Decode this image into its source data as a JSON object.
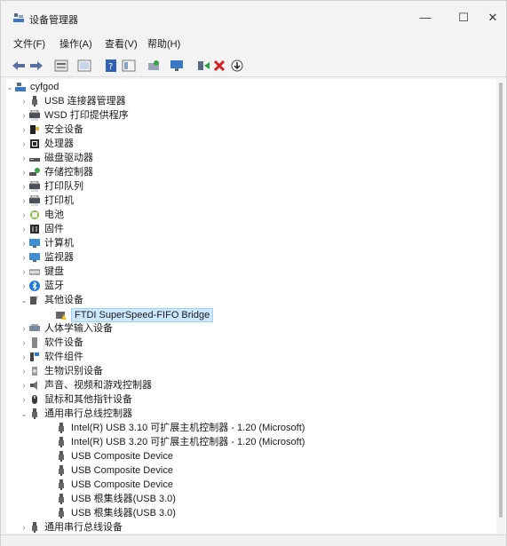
{
  "window": {
    "title": "设备管理器",
    "minimize": "—",
    "maximize": "☐",
    "close": "✕"
  },
  "menu": [
    "文件(F)",
    "操作(A)",
    "查看(V)",
    "帮助(H)"
  ],
  "toolbar_icons": [
    "back-arrow-icon",
    "forward-arrow-icon",
    "properties-icon",
    "console-tree-icon",
    "help-icon",
    "view-icon",
    "update-driver-icon",
    "scan-hardware-icon",
    "enable-device-icon",
    "uninstall-icon",
    "download-icon"
  ],
  "tree": [
    {
      "level": 0,
      "expand": "open",
      "icon": "computer",
      "label": "cyfgod"
    },
    {
      "level": 1,
      "expand": "closed",
      "icon": "usb",
      "label": "USB 连接器管理器"
    },
    {
      "level": 1,
      "expand": "closed",
      "icon": "printer",
      "label": "WSD 打印提供程序"
    },
    {
      "level": 1,
      "expand": "closed",
      "icon": "security",
      "label": "安全设备"
    },
    {
      "level": 1,
      "expand": "closed",
      "icon": "cpu",
      "label": "处理器"
    },
    {
      "level": 1,
      "expand": "closed",
      "icon": "disk",
      "label": "磁盘驱动器"
    },
    {
      "level": 1,
      "expand": "closed",
      "icon": "storage",
      "label": "存储控制器"
    },
    {
      "level": 1,
      "expand": "closed",
      "icon": "printer",
      "label": "打印队列"
    },
    {
      "level": 1,
      "expand": "closed",
      "icon": "printer",
      "label": "打印机"
    },
    {
      "level": 1,
      "expand": "closed",
      "icon": "battery",
      "label": "电池"
    },
    {
      "level": 1,
      "expand": "closed",
      "icon": "firmware",
      "label": "固件"
    },
    {
      "level": 1,
      "expand": "closed",
      "icon": "monitor",
      "label": "计算机"
    },
    {
      "level": 1,
      "expand": "closed",
      "icon": "monitor",
      "label": "监视器"
    },
    {
      "level": 1,
      "expand": "closed",
      "icon": "keyboard",
      "label": "键盘"
    },
    {
      "level": 1,
      "expand": "closed",
      "icon": "bluetooth",
      "label": "蓝牙"
    },
    {
      "level": 1,
      "expand": "open",
      "icon": "unknown",
      "label": "其他设备"
    },
    {
      "level": 2,
      "expand": "none",
      "icon": "warning-device",
      "label": "FTDI SuperSpeed-FIFO Bridge",
      "selected": true
    },
    {
      "level": 1,
      "expand": "closed",
      "icon": "hid",
      "label": "人体学输入设备"
    },
    {
      "level": 1,
      "expand": "closed",
      "icon": "software",
      "label": "软件设备"
    },
    {
      "level": 1,
      "expand": "closed",
      "icon": "component",
      "label": "软件组件"
    },
    {
      "level": 1,
      "expand": "closed",
      "icon": "biometric",
      "label": "生物识别设备"
    },
    {
      "level": 1,
      "expand": "closed",
      "icon": "audio",
      "label": "声音、视频和游戏控制器"
    },
    {
      "level": 1,
      "expand": "closed",
      "icon": "mouse",
      "label": "鼠标和其他指针设备"
    },
    {
      "level": 1,
      "expand": "open",
      "icon": "usb",
      "label": "通用串行总线控制器"
    },
    {
      "level": 2,
      "expand": "none",
      "icon": "usb",
      "label": "Intel(R) USB 3.10 可扩展主机控制器 - 1.20 (Microsoft)"
    },
    {
      "level": 2,
      "expand": "none",
      "icon": "usb",
      "label": "Intel(R) USB 3.20 可扩展主机控制器 - 1.20 (Microsoft)"
    },
    {
      "level": 2,
      "expand": "none",
      "icon": "usb",
      "label": "USB Composite Device"
    },
    {
      "level": 2,
      "expand": "none",
      "icon": "usb",
      "label": "USB Composite Device"
    },
    {
      "level": 2,
      "expand": "none",
      "icon": "usb",
      "label": "USB Composite Device"
    },
    {
      "level": 2,
      "expand": "none",
      "icon": "usb",
      "label": "USB 根集线器(USB 3.0)"
    },
    {
      "level": 2,
      "expand": "none",
      "icon": "usb",
      "label": "USB 根集线器(USB 3.0)"
    },
    {
      "level": 1,
      "expand": "closed",
      "icon": "usb",
      "label": "通用串行总线设备"
    }
  ]
}
